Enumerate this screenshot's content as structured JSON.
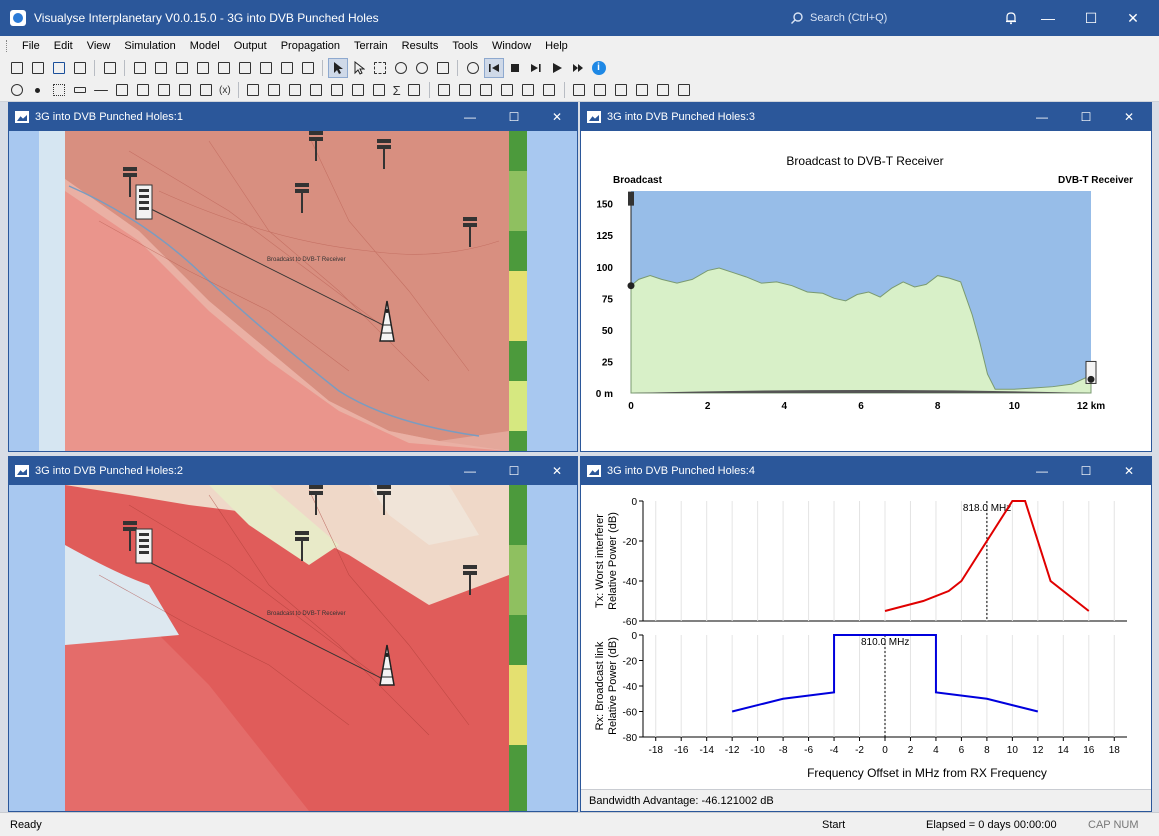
{
  "app": {
    "title": "Visualyse Interplanetary V0.0.15.0 - 3G into DVB Punched Holes",
    "search_placeholder": "Search (Ctrl+Q)",
    "window_controls": {
      "minimize": "—",
      "maximize": "☐",
      "close": "✕"
    }
  },
  "menu": [
    "File",
    "Edit",
    "View",
    "Simulation",
    "Model",
    "Output",
    "Propagation",
    "Terrain",
    "Results",
    "Tools",
    "Window",
    "Help"
  ],
  "toolbar": {
    "expression_label": "(x)",
    "sigma_label": "Σ",
    "info_label": "i"
  },
  "windows": {
    "map1": {
      "title": "3G into DVB Punched Holes:1",
      "link_label": "Broadcast to DVB-T Receiver"
    },
    "map2": {
      "title": "3G into DVB Punched Holes:2",
      "link_label": "Broadcast to DVB-T Receiver"
    },
    "profile": {
      "title": "3G into DVB Punched Holes:3"
    },
    "mask": {
      "title": "3G into DVB Punched Holes:4",
      "bandwidth_advantage": "Bandwidth Advantage: -46.121002 dB"
    }
  },
  "chart_data": [
    {
      "type": "area",
      "title": "Broadcast  to  DVB-T Receiver",
      "left_label": "Broadcast",
      "right_label": "DVB-T Receiver",
      "xlabel": "km",
      "ylabel": "m",
      "xlim": [
        0,
        12
      ],
      "ylim": [
        0,
        160
      ],
      "x_ticks": [
        "0",
        "2",
        "4",
        "6",
        "8",
        "10",
        "12 km"
      ],
      "y_ticks": [
        "0 m",
        "25",
        "50",
        "75",
        "100",
        "125",
        "150"
      ],
      "series": [
        {
          "x": [
            0,
            0.2,
            0.5,
            0.8,
            1.2,
            1.6,
            2.0,
            2.3,
            2.7,
            3.0,
            3.4,
            3.8,
            4.2,
            4.6,
            5.0,
            5.3,
            5.6,
            5.9,
            6.2,
            6.5,
            6.8,
            7.1,
            7.4,
            7.7,
            8.0,
            8.3,
            8.6,
            8.9,
            9.1,
            9.3,
            9.5,
            10.0,
            10.5,
            11.0,
            11.5,
            12.0
          ],
          "y": [
            85,
            90,
            93,
            90,
            87,
            90,
            97,
            99,
            95,
            92,
            87,
            88,
            85,
            80,
            79,
            75,
            73,
            78,
            80,
            76,
            83,
            88,
            84,
            86,
            93,
            91,
            88,
            62,
            40,
            15,
            3,
            3,
            4,
            5,
            7,
            14
          ]
        }
      ],
      "annotations": [
        "Broadcast",
        "DVB-T Receiver"
      ]
    },
    {
      "type": "line",
      "title": "",
      "xlabel": "Frequency Offset in MHz from RX Frequency",
      "ylabel": "Tx: Worst interferer Relative Power (dB)",
      "xlim": [
        -19,
        19
      ],
      "ylim": [
        -60,
        0
      ],
      "y_ticks": [
        "0",
        "-20",
        "-40",
        "-60"
      ],
      "marker_label": "818.0 MHz",
      "marker_x": 8,
      "series": [
        {
          "name": "",
          "color": "#e00000",
          "x": [
            0,
            3,
            5,
            6,
            10,
            11,
            13,
            16
          ],
          "y": [
            -55,
            -50,
            -45,
            -40,
            0,
            0,
            -40,
            -55
          ]
        }
      ]
    },
    {
      "type": "line",
      "title": "",
      "xlabel": "Frequency Offset in MHz from RX Frequency",
      "ylabel": "Rx: Broadcast link Relative Power (dB)",
      "xlim": [
        -19,
        19
      ],
      "ylim": [
        -80,
        0
      ],
      "x_ticks": [
        "-18",
        "-16",
        "-14",
        "-12",
        "-10",
        "-8",
        "-6",
        "-4",
        "-2",
        "0",
        "2",
        "4",
        "6",
        "8",
        "10",
        "12",
        "14",
        "16",
        "18"
      ],
      "y_ticks": [
        "0",
        "-20",
        "-40",
        "-60",
        "-80"
      ],
      "marker_label": "810.0 MHz",
      "marker_x": 0,
      "series": [
        {
          "name": "",
          "color": "#0000dd",
          "x": [
            -12,
            -8,
            -4,
            -4,
            4,
            4,
            8,
            12
          ],
          "y": [
            -60,
            -50,
            -45,
            0,
            0,
            -45,
            -50,
            -60
          ]
        }
      ]
    }
  ],
  "status": {
    "ready": "Ready",
    "start": "Start",
    "elapsed": "Elapsed = 0 days 00:00:00",
    "caps": "CAP  NUM"
  },
  "colors": {
    "title_bar": "#2b579a",
    "coverage_red": "#e05050",
    "sea": "#a8c8f0",
    "terrain_fill": "#d8f0c8",
    "tx_curve": "#e00000",
    "rx_curve": "#0000dd"
  }
}
